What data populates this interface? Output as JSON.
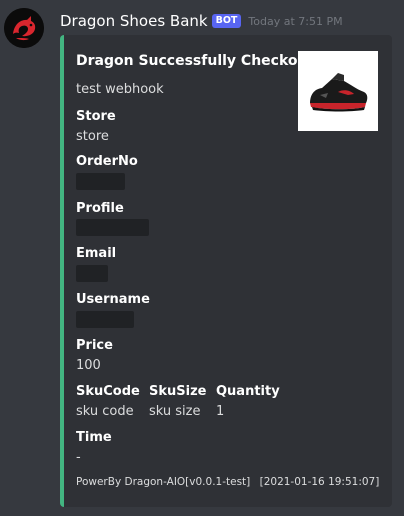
{
  "message": {
    "username": "Dragon Shoes Bank",
    "bot_tag": "BOT",
    "timestamp": "Today at 7:51 PM"
  },
  "embed": {
    "accent_color": "#43b581",
    "title": "Dragon Successfully Checkout",
    "description": "test webhook",
    "thumbnail": "sneaker-image",
    "fields": {
      "store": {
        "name": "Store",
        "value": "store"
      },
      "order_no": {
        "name": "OrderNo",
        "value": ""
      },
      "profile": {
        "name": "Profile",
        "value": ""
      },
      "email": {
        "name": "Email",
        "value": ""
      },
      "username": {
        "name": "Username",
        "value": ""
      },
      "price": {
        "name": "Price",
        "value": "100"
      },
      "sku_code": {
        "name": "SkuCode",
        "value": "sku code"
      },
      "sku_size": {
        "name": "SkuSize",
        "value": "sku size"
      },
      "quantity": {
        "name": "Quantity",
        "value": "1"
      },
      "time": {
        "name": "Time",
        "value": "-"
      }
    },
    "footer": {
      "text": "PowerBy Dragon-AIO[v0.0.1-test]",
      "timestamp": "[2021-01-16 19:51:07]"
    }
  }
}
